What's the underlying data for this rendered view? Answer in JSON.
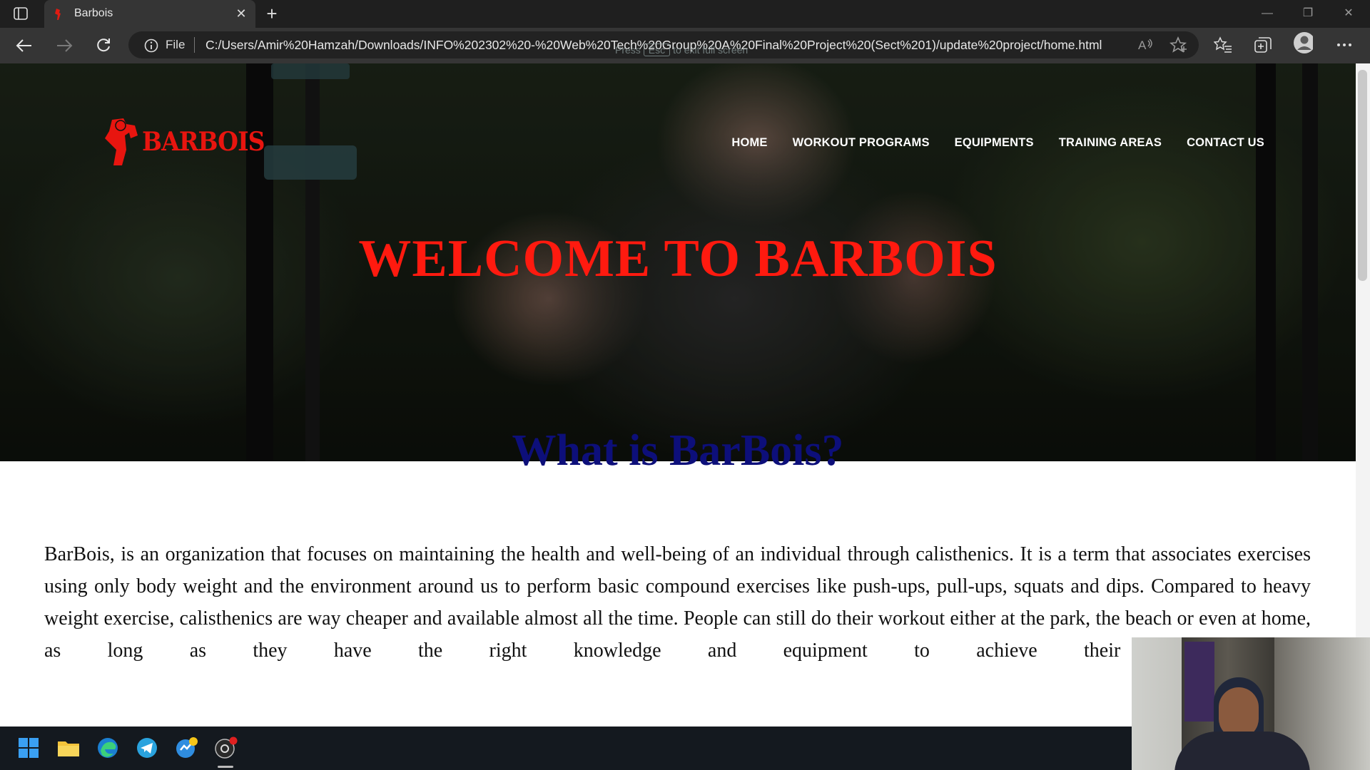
{
  "browser": {
    "tab_title": "Barbois",
    "scheme_label": "File",
    "url": "C:/Users/Amir%20Hamzah/Downloads/INFO%202302%20-%20Web%20Tech%20Group%20A%20Final%20Project%20(Sect%201)/update%20project/home.html",
    "fullscreen_hint_prefix": "Press",
    "fullscreen_hint_key": "Esc",
    "fullscreen_hint_suffix": "to exit full screen"
  },
  "site": {
    "logo_text": "BARBOIS",
    "nav": [
      "HOME",
      "WORKOUT PROGRAMS",
      "EQUIPMENTS",
      "TRAINING AREAS",
      "CONTACT US"
    ],
    "hero_title": "WELCOME TO BARBOIS",
    "section_title": "What is BarBois?",
    "paragraph": "BarBois, is an organization that focuses on maintaining the health and well-being of an individual through calisthenics. It is a term that associates exercises using only body weight and the environment around us to perform basic compound exercises like push-ups, pull-ups, squats and dips. Compared to heavy weight exercise, calisthenics are way cheaper and available almost all the time. People can still do their workout either at the park, the beach or even at home, as long as they have the right knowledge and equipment to achieve their desired goal."
  },
  "taskbar_icons": [
    "windows-start-icon",
    "file-explorer-icon",
    "edge-icon",
    "telegram-icon",
    "app-icon",
    "obs-icon"
  ],
  "colors": {
    "accent_red": "#ff1a0f",
    "heading_navy": "#0d0f7a",
    "chrome_dark": "#1f1f1f"
  }
}
